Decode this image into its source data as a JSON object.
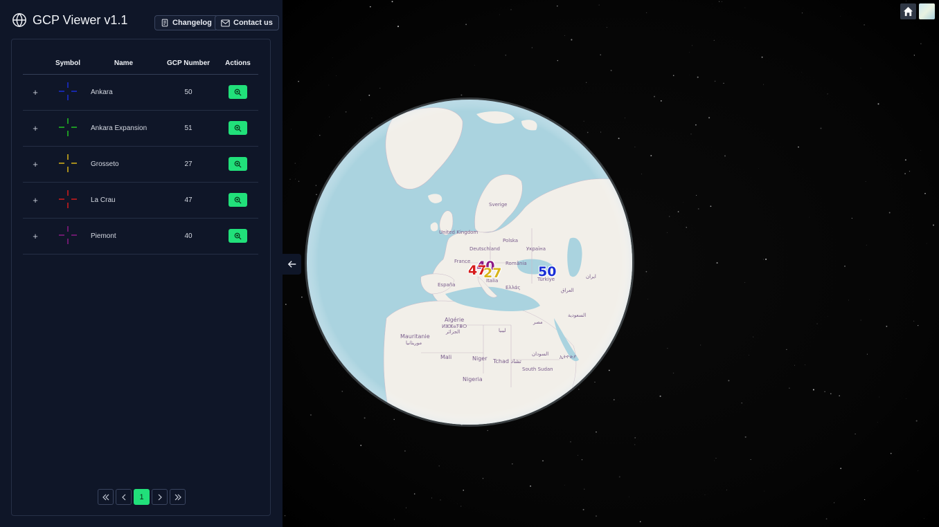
{
  "app": {
    "title": "GCP Viewer v1.1"
  },
  "header": {
    "changelog_label": "Changelog",
    "contact_label": "Contact us"
  },
  "table": {
    "headers": {
      "symbol": "Symbol",
      "name": "Name",
      "gcp_number": "GCP Number",
      "actions": "Actions"
    },
    "rows": [
      {
        "name": "Ankara",
        "gcp_number": "50",
        "color": "#1a2fd6"
      },
      {
        "name": "Ankara Expansion",
        "gcp_number": "51",
        "color": "#22c422"
      },
      {
        "name": "Grosseto",
        "gcp_number": "27",
        "color": "#d8b418"
      },
      {
        "name": "La Crau",
        "gcp_number": "47",
        "color": "#d61c1c"
      },
      {
        "name": "Piemont",
        "gcp_number": "40",
        "color": "#8c1a86"
      }
    ]
  },
  "pagination": {
    "current_page": "1"
  },
  "globe": {
    "markers": [
      {
        "label": "40",
        "color": "#8c1a86"
      },
      {
        "label": "47",
        "color": "#d61c1c"
      },
      {
        "label": "27",
        "color": "#d8b418"
      },
      {
        "label": "50",
        "color": "#1a2fd6"
      }
    ],
    "place_labels": [
      "France",
      "España",
      "Italia",
      "Deutschland",
      "Polska",
      "Україна",
      "România",
      "Türkiye",
      "Ελλάς",
      "Algérie",
      "ⵍⵣⵣⴰⵢⴻⵔ",
      "الجزائر",
      "Mauritanie",
      "موريتانيا",
      "ليبيا",
      "مصر",
      "Mali",
      "Niger",
      "Tchad تشاد",
      "السودان",
      "South Sudan",
      "Nigeria",
      "ኢትዮጵያ",
      "السعودية",
      "العراق",
      "ایران",
      "United Kingdom",
      "Sverige"
    ]
  },
  "colors": {
    "accent": "#21e07a",
    "sidebar_bg": "#0f1628",
    "ocean": "#aad3df",
    "land": "#f2efe9"
  },
  "icons": {
    "brand": "globe-icon",
    "changelog": "document-icon",
    "contact": "mail-icon",
    "expand": "plus-icon",
    "zoom": "zoom-in-icon",
    "collapse": "arrow-left-icon",
    "home": "home-icon",
    "basemap": "basemap-thumbnail-icon"
  }
}
